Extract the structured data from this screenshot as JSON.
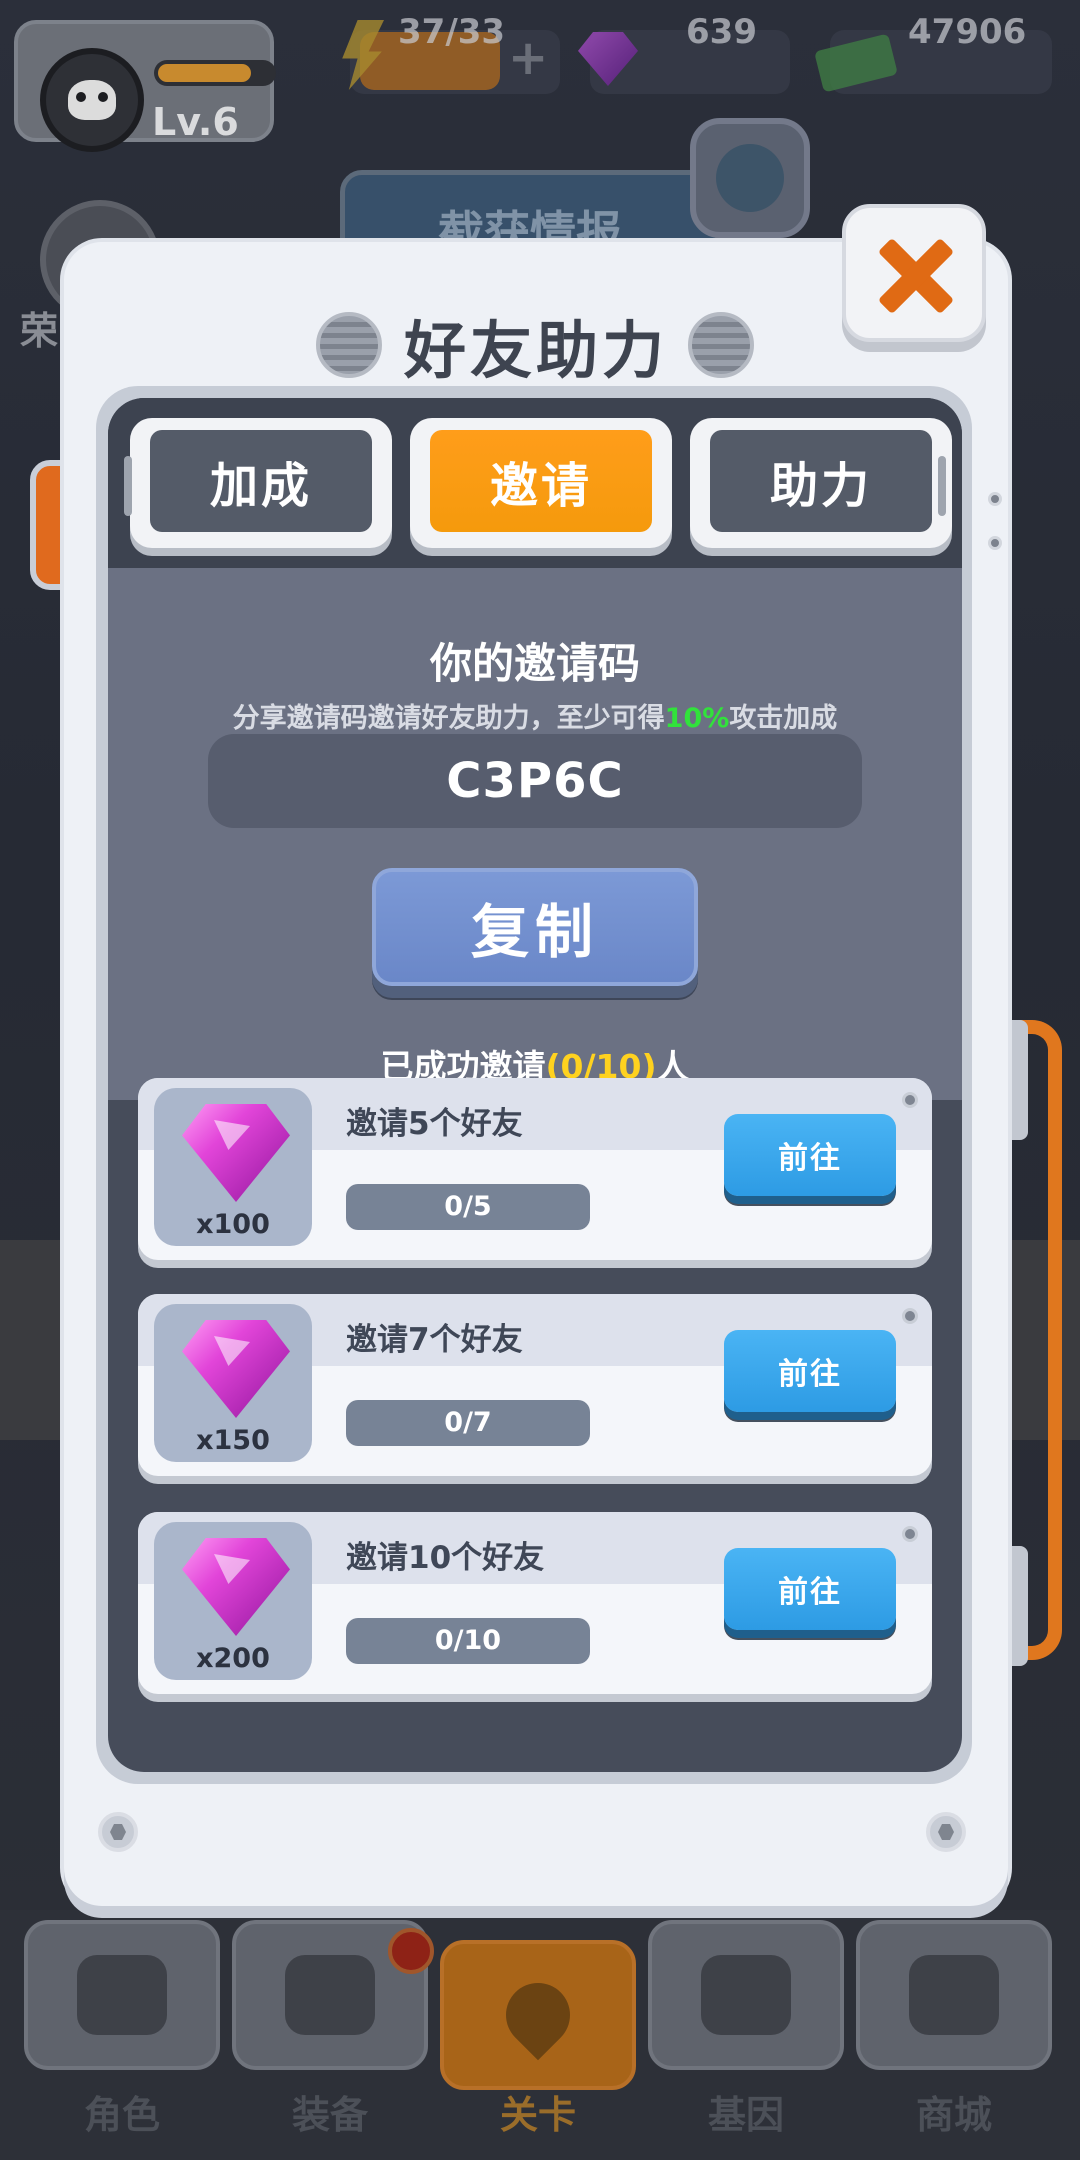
{
  "hud": {
    "level": "Lv.6",
    "exp_progress": 0.82,
    "energy": "37/33",
    "gems": "639",
    "cash": "47906"
  },
  "background": {
    "intel_label": "截获情报",
    "left_badge_label": "荣"
  },
  "modal": {
    "title": "好友助力",
    "tabs": [
      {
        "label": "加成",
        "active": false
      },
      {
        "label": "邀请",
        "active": true
      },
      {
        "label": "助力",
        "active": false
      }
    ],
    "invite": {
      "title": "你的邀请码",
      "desc_prefix": "分享邀请码邀请好友助力，至少可得",
      "desc_highlight": "10%",
      "desc_suffix": "攻击加成",
      "code": "C3P6C",
      "copy_label": "复制",
      "invited_prefix": "已成功邀请",
      "invited_count": "(0/10)",
      "invited_suffix": "人"
    },
    "tasks": [
      {
        "title": "邀请5个好友",
        "reward": "x100",
        "progress": "0/5",
        "button": "前往"
      },
      {
        "title": "邀请7个好友",
        "reward": "x150",
        "progress": "0/7",
        "button": "前往"
      },
      {
        "title": "邀请10个好友",
        "reward": "x200",
        "progress": "0/10",
        "button": "前往"
      }
    ]
  },
  "bottom_nav": [
    {
      "label": "角色",
      "icon": "skull-icon",
      "active": false
    },
    {
      "label": "装备",
      "icon": "gun-icon",
      "active": false
    },
    {
      "label": "关卡",
      "icon": "map-pin-icon",
      "active": true
    },
    {
      "label": "基因",
      "icon": "hexagons-icon",
      "active": false
    },
    {
      "label": "商城",
      "icon": "shop-icon",
      "active": false
    }
  ],
  "colors": {
    "accent_orange": "#f59a0c",
    "highlight_green": "#31e23b",
    "highlight_yellow": "#ffd21f",
    "go_button_blue": "#2d9be4",
    "copy_button_blue": "#6a87c8"
  }
}
